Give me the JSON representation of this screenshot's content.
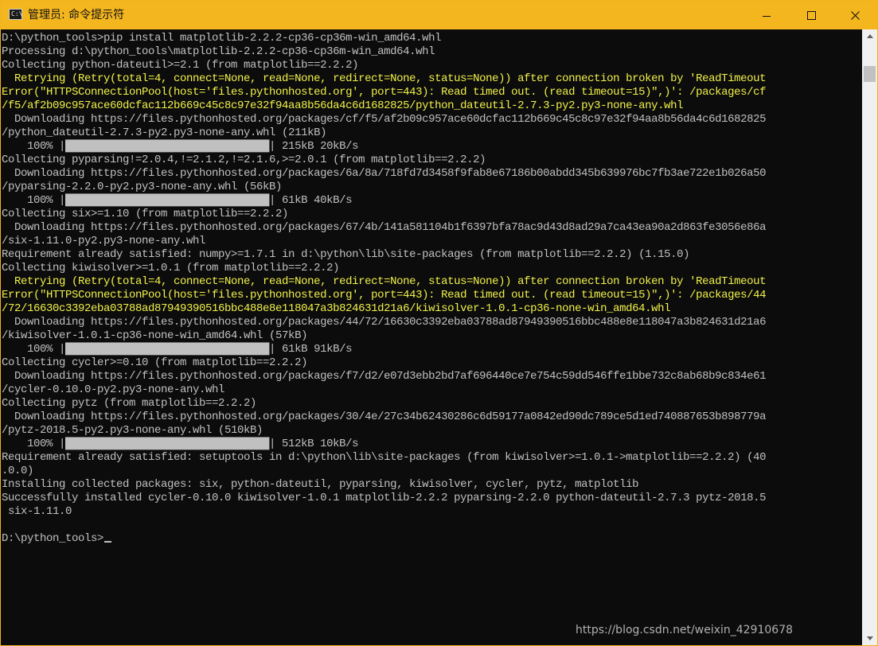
{
  "window": {
    "title": "管理员: 命令提示符",
    "accent_color": "#f4b61f",
    "icon": "console-app-icon",
    "icon_glyph": "C:\\"
  },
  "controls": {
    "minimize": "minimize-icon",
    "maximize": "maximize-icon",
    "close": "close-icon"
  },
  "console": {
    "text_color": "#c0c0c0",
    "warning_color": "#f1f14a",
    "lines": [
      {
        "text": "D:\\python_tools>pip install matplotlib-2.2.2-cp36-cp36m-win_amd64.whl",
        "type": "normal"
      },
      {
        "text": "Processing d:\\python_tools\\matplotlib-2.2.2-cp36-cp36m-win_amd64.whl",
        "type": "normal"
      },
      {
        "text": "Collecting python-dateutil>=2.1 (from matplotlib==2.2.2)",
        "type": "normal"
      },
      {
        "text": "  Retrying (Retry(total=4, connect=None, read=None, redirect=None, status=None)) after connection broken by 'ReadTimeout",
        "type": "warn"
      },
      {
        "text": "Error(\"HTTPSConnectionPool(host='files.pythonhosted.org', port=443): Read timed out. (read timeout=15)\",)': /packages/cf",
        "type": "warn"
      },
      {
        "text": "/f5/af2b09c957ace60dcfac112b669c45c8c97e32f94aa8b56da4c6d1682825/python_dateutil-2.7.3-py2.py3-none-any.whl",
        "type": "warn"
      },
      {
        "text": "  Downloading https://files.pythonhosted.org/packages/cf/f5/af2b09c957ace60dcfac112b669c45c8c97e32f94aa8b56da4c6d1682825",
        "type": "normal"
      },
      {
        "text": "/python_dateutil-2.7.3-py2.py3-none-any.whl (211kB)",
        "type": "normal"
      },
      {
        "text": "    100% |████████████████████████████████| 215kB 20kB/s",
        "type": "normal"
      },
      {
        "text": "Collecting pyparsing!=2.0.4,!=2.1.2,!=2.1.6,>=2.0.1 (from matplotlib==2.2.2)",
        "type": "normal"
      },
      {
        "text": "  Downloading https://files.pythonhosted.org/packages/6a/8a/718fd7d3458f9fab8e67186b00abdd345b639976bc7fb3ae722e1b026a50",
        "type": "normal"
      },
      {
        "text": "/pyparsing-2.2.0-py2.py3-none-any.whl (56kB)",
        "type": "normal"
      },
      {
        "text": "    100% |████████████████████████████████| 61kB 40kB/s",
        "type": "normal"
      },
      {
        "text": "Collecting six>=1.10 (from matplotlib==2.2.2)",
        "type": "normal"
      },
      {
        "text": "  Downloading https://files.pythonhosted.org/packages/67/4b/141a581104b1f6397bfa78ac9d43d8ad29a7ca43ea90a2d863fe3056e86a",
        "type": "normal"
      },
      {
        "text": "/six-1.11.0-py2.py3-none-any.whl",
        "type": "normal"
      },
      {
        "text": "Requirement already satisfied: numpy>=1.7.1 in d:\\python\\lib\\site-packages (from matplotlib==2.2.2) (1.15.0)",
        "type": "normal"
      },
      {
        "text": "Collecting kiwisolver>=1.0.1 (from matplotlib==2.2.2)",
        "type": "normal"
      },
      {
        "text": "  Retrying (Retry(total=4, connect=None, read=None, redirect=None, status=None)) after connection broken by 'ReadTimeout",
        "type": "warn"
      },
      {
        "text": "Error(\"HTTPSConnectionPool(host='files.pythonhosted.org', port=443): Read timed out. (read timeout=15)\",)': /packages/44",
        "type": "warn"
      },
      {
        "text": "/72/16630c3392eba03788ad87949390516bbc488e8e118047a3b824631d21a6/kiwisolver-1.0.1-cp36-none-win_amd64.whl",
        "type": "warn"
      },
      {
        "text": "  Downloading https://files.pythonhosted.org/packages/44/72/16630c3392eba03788ad87949390516bbc488e8e118047a3b824631d21a6",
        "type": "normal"
      },
      {
        "text": "/kiwisolver-1.0.1-cp36-none-win_amd64.whl (57kB)",
        "type": "normal"
      },
      {
        "text": "    100% |████████████████████████████████| 61kB 91kB/s",
        "type": "normal"
      },
      {
        "text": "Collecting cycler>=0.10 (from matplotlib==2.2.2)",
        "type": "normal"
      },
      {
        "text": "  Downloading https://files.pythonhosted.org/packages/f7/d2/e07d3ebb2bd7af696440ce7e754c59dd546ffe1bbe732c8ab68b9c834e61",
        "type": "normal"
      },
      {
        "text": "/cycler-0.10.0-py2.py3-none-any.whl",
        "type": "normal"
      },
      {
        "text": "Collecting pytz (from matplotlib==2.2.2)",
        "type": "normal"
      },
      {
        "text": "  Downloading https://files.pythonhosted.org/packages/30/4e/27c34b62430286c6d59177a0842ed90dc789ce5d1ed740887653b898779a",
        "type": "normal"
      },
      {
        "text": "/pytz-2018.5-py2.py3-none-any.whl (510kB)",
        "type": "normal"
      },
      {
        "text": "    100% |████████████████████████████████| 512kB 10kB/s",
        "type": "normal"
      },
      {
        "text": "Requirement already satisfied: setuptools in d:\\python\\lib\\site-packages (from kiwisolver>=1.0.1->matplotlib==2.2.2) (40",
        "type": "normal"
      },
      {
        "text": ".0.0)",
        "type": "normal"
      },
      {
        "text": "Installing collected packages: six, python-dateutil, pyparsing, kiwisolver, cycler, pytz, matplotlib",
        "type": "normal"
      },
      {
        "text": "Successfully installed cycler-0.10.0 kiwisolver-1.0.1 matplotlib-2.2.2 pyparsing-2.2.0 python-dateutil-2.7.3 pytz-2018.5",
        "type": "normal"
      },
      {
        "text": " six-1.11.0",
        "type": "normal"
      },
      {
        "text": "",
        "type": "normal"
      },
      {
        "text": "D:\\python_tools>",
        "type": "prompt"
      }
    ]
  },
  "scrollbar": {
    "up": "scroll-up-arrow-icon",
    "down": "scroll-down-arrow-icon"
  },
  "watermark": "https://blog.csdn.net/weixin_42910678"
}
